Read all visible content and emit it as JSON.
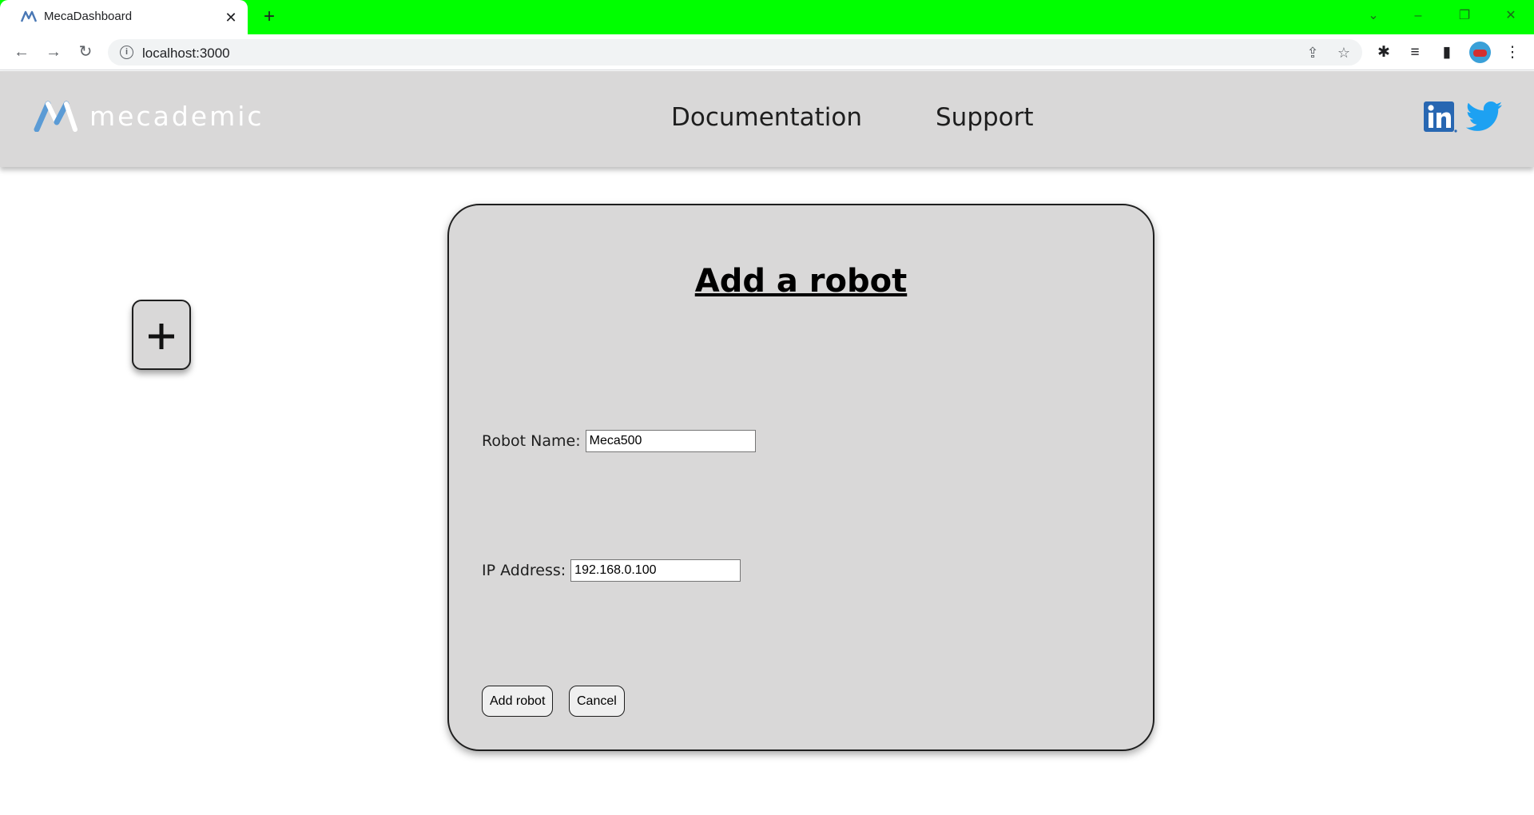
{
  "browser": {
    "tab_title": "MecaDashboard",
    "tab_close": "✕",
    "new_tab": "+",
    "url": "localhost:3000"
  },
  "header": {
    "logo_text": "mecademic",
    "nav": {
      "documentation": "Documentation",
      "support": "Support"
    },
    "social": [
      "linkedin-icon",
      "twitter-icon"
    ]
  },
  "page": {
    "add_tile_symbol": "+"
  },
  "modal": {
    "title": "Add a robot",
    "robot_name_label": "Robot Name:",
    "robot_name_value": "Meca500",
    "ip_label": "IP Address:",
    "ip_value": "192.168.0.100",
    "add_button": "Add robot",
    "cancel_button": "Cancel"
  },
  "colors": {
    "tab_strip": "#00ff00",
    "header_bg": "#d9d8d8",
    "linkedin": "#2867b2",
    "twitter": "#1da1f2",
    "logo_accent": "#5b9bd5"
  }
}
